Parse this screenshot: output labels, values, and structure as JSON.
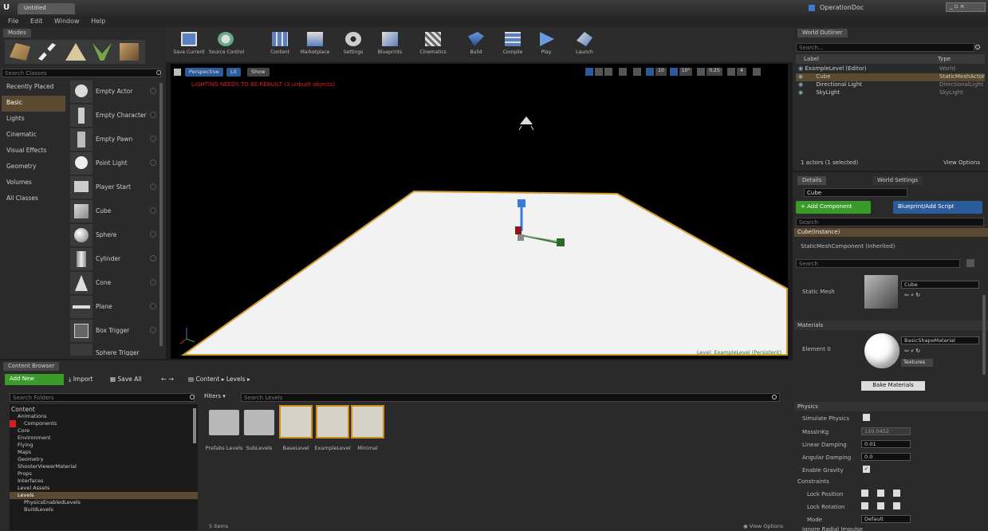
{
  "window": {
    "title": "Untitled",
    "project": "OperationDoc"
  },
  "menu": [
    "File",
    "Edit",
    "Window",
    "Help"
  ],
  "modes_tab": "Modes",
  "modes_search_placeholder": "Search Classes",
  "place_categories": [
    {
      "label": "Recently Placed",
      "selected": false
    },
    {
      "label": "Basic",
      "selected": true
    },
    {
      "label": "Lights",
      "selected": false
    },
    {
      "label": "Cinematic",
      "selected": false
    },
    {
      "label": "Visual Effects",
      "selected": false
    },
    {
      "label": "Geometry",
      "selected": false
    },
    {
      "label": "Volumes",
      "selected": false
    },
    {
      "label": "All Classes",
      "selected": false
    }
  ],
  "place_items": [
    "Empty Actor",
    "Empty Character",
    "Empty Pawn",
    "Point Light",
    "Player Start",
    "Cube",
    "Sphere",
    "Cylinder",
    "Cone",
    "Plane",
    "Box Trigger",
    "Sphere Trigger"
  ],
  "toolbar": [
    "Save Current",
    "Source Control",
    "Content",
    "Marketplace",
    "Settings",
    "Blueprints",
    "Cinematics",
    "Build",
    "Compile",
    "Play",
    "Launch"
  ],
  "viewport": {
    "perspective": "Perspective",
    "lit": "Lit",
    "show": "Show",
    "warning": "LIGHTING NEEDS TO BE REBUILT (3 unbuilt objects)",
    "level_prefix": "Level:",
    "level_name": "ExampleLevel (Persistent)",
    "grid_value": "10",
    "angle_value": "10°",
    "scale_value": "0.25",
    "camera_speed": "4"
  },
  "world_outliner": {
    "tab": "World Outliner",
    "search_placeholder": "Search...",
    "col_label": "Label",
    "col_type": "Type",
    "rows": [
      {
        "label": "ExampleLevel (Editor)",
        "type": "World",
        "selected": false
      },
      {
        "label": "Cube",
        "type": "StaticMeshActor",
        "selected": true
      },
      {
        "label": "Directional Light",
        "type": "DirectionalLight",
        "selected": false
      },
      {
        "label": "SkyLight",
        "type": "SkyLight",
        "selected": false
      }
    ],
    "footer": "1 actors (1 selected)",
    "view_options": "View Options"
  },
  "details": {
    "tab_details": "Details",
    "tab_world": "World Settings",
    "name_value": "Cube",
    "add_component": "+ Add Component",
    "blueprint_script": "Blueprint/Add Script",
    "search_comp_placeholder": "Search",
    "component_root": "Cube(Instance)",
    "component_child": "StaticMeshComponent (Inherited)",
    "search_details_placeholder": "Search",
    "static_mesh_label": "Static Mesh",
    "static_mesh_value": "Cube",
    "materials_section": "Materials",
    "element_label": "Element 0",
    "material_value": "BasicShapeMaterial",
    "textures_btn": "Textures",
    "bake_btn": "Bake Materials",
    "physics_section": "Physics",
    "simulate_physics": "Simulate Physics",
    "mass_label": "MassInKg",
    "mass_value": "110.0452",
    "linear_damping_label": "Linear Damping",
    "linear_damping_value": "0.01",
    "angular_damping_label": "Angular Damping",
    "angular_damping_value": "0.0",
    "enable_gravity": "Enable Gravity",
    "constraints_section": "Constraints",
    "lock_position": "Lock Position",
    "lock_rotation": "Lock Rotation",
    "mode_label": "Mode",
    "mode_value": "Default",
    "ignore_radial": "Ignore Radial Impulse"
  },
  "content_browser": {
    "tab": "Content Browser",
    "add_new": "Add New",
    "import": "Import",
    "save_all": "Save All",
    "path": [
      "Content",
      "Levels"
    ],
    "search_folders_placeholder": "Search Folders",
    "filters": "Filters",
    "search_assets_placeholder": "Search Levels",
    "tree": [
      "Content",
      "Animations",
      "Components",
      "Core",
      "Environment",
      "Flying",
      "Maps",
      "Geometry",
      "ShooterViewerMaterial",
      "Props",
      "Interfaces",
      "Level Assets",
      "Levels",
      "PhysicsEnabledLevels",
      "BuildLevels"
    ],
    "assets": [
      "Prefabs Levels",
      "SubLevels",
      "BaseLevel",
      "ExampleLevel",
      "Minimal"
    ],
    "item_count": "5 items",
    "view_options": "View Options"
  }
}
